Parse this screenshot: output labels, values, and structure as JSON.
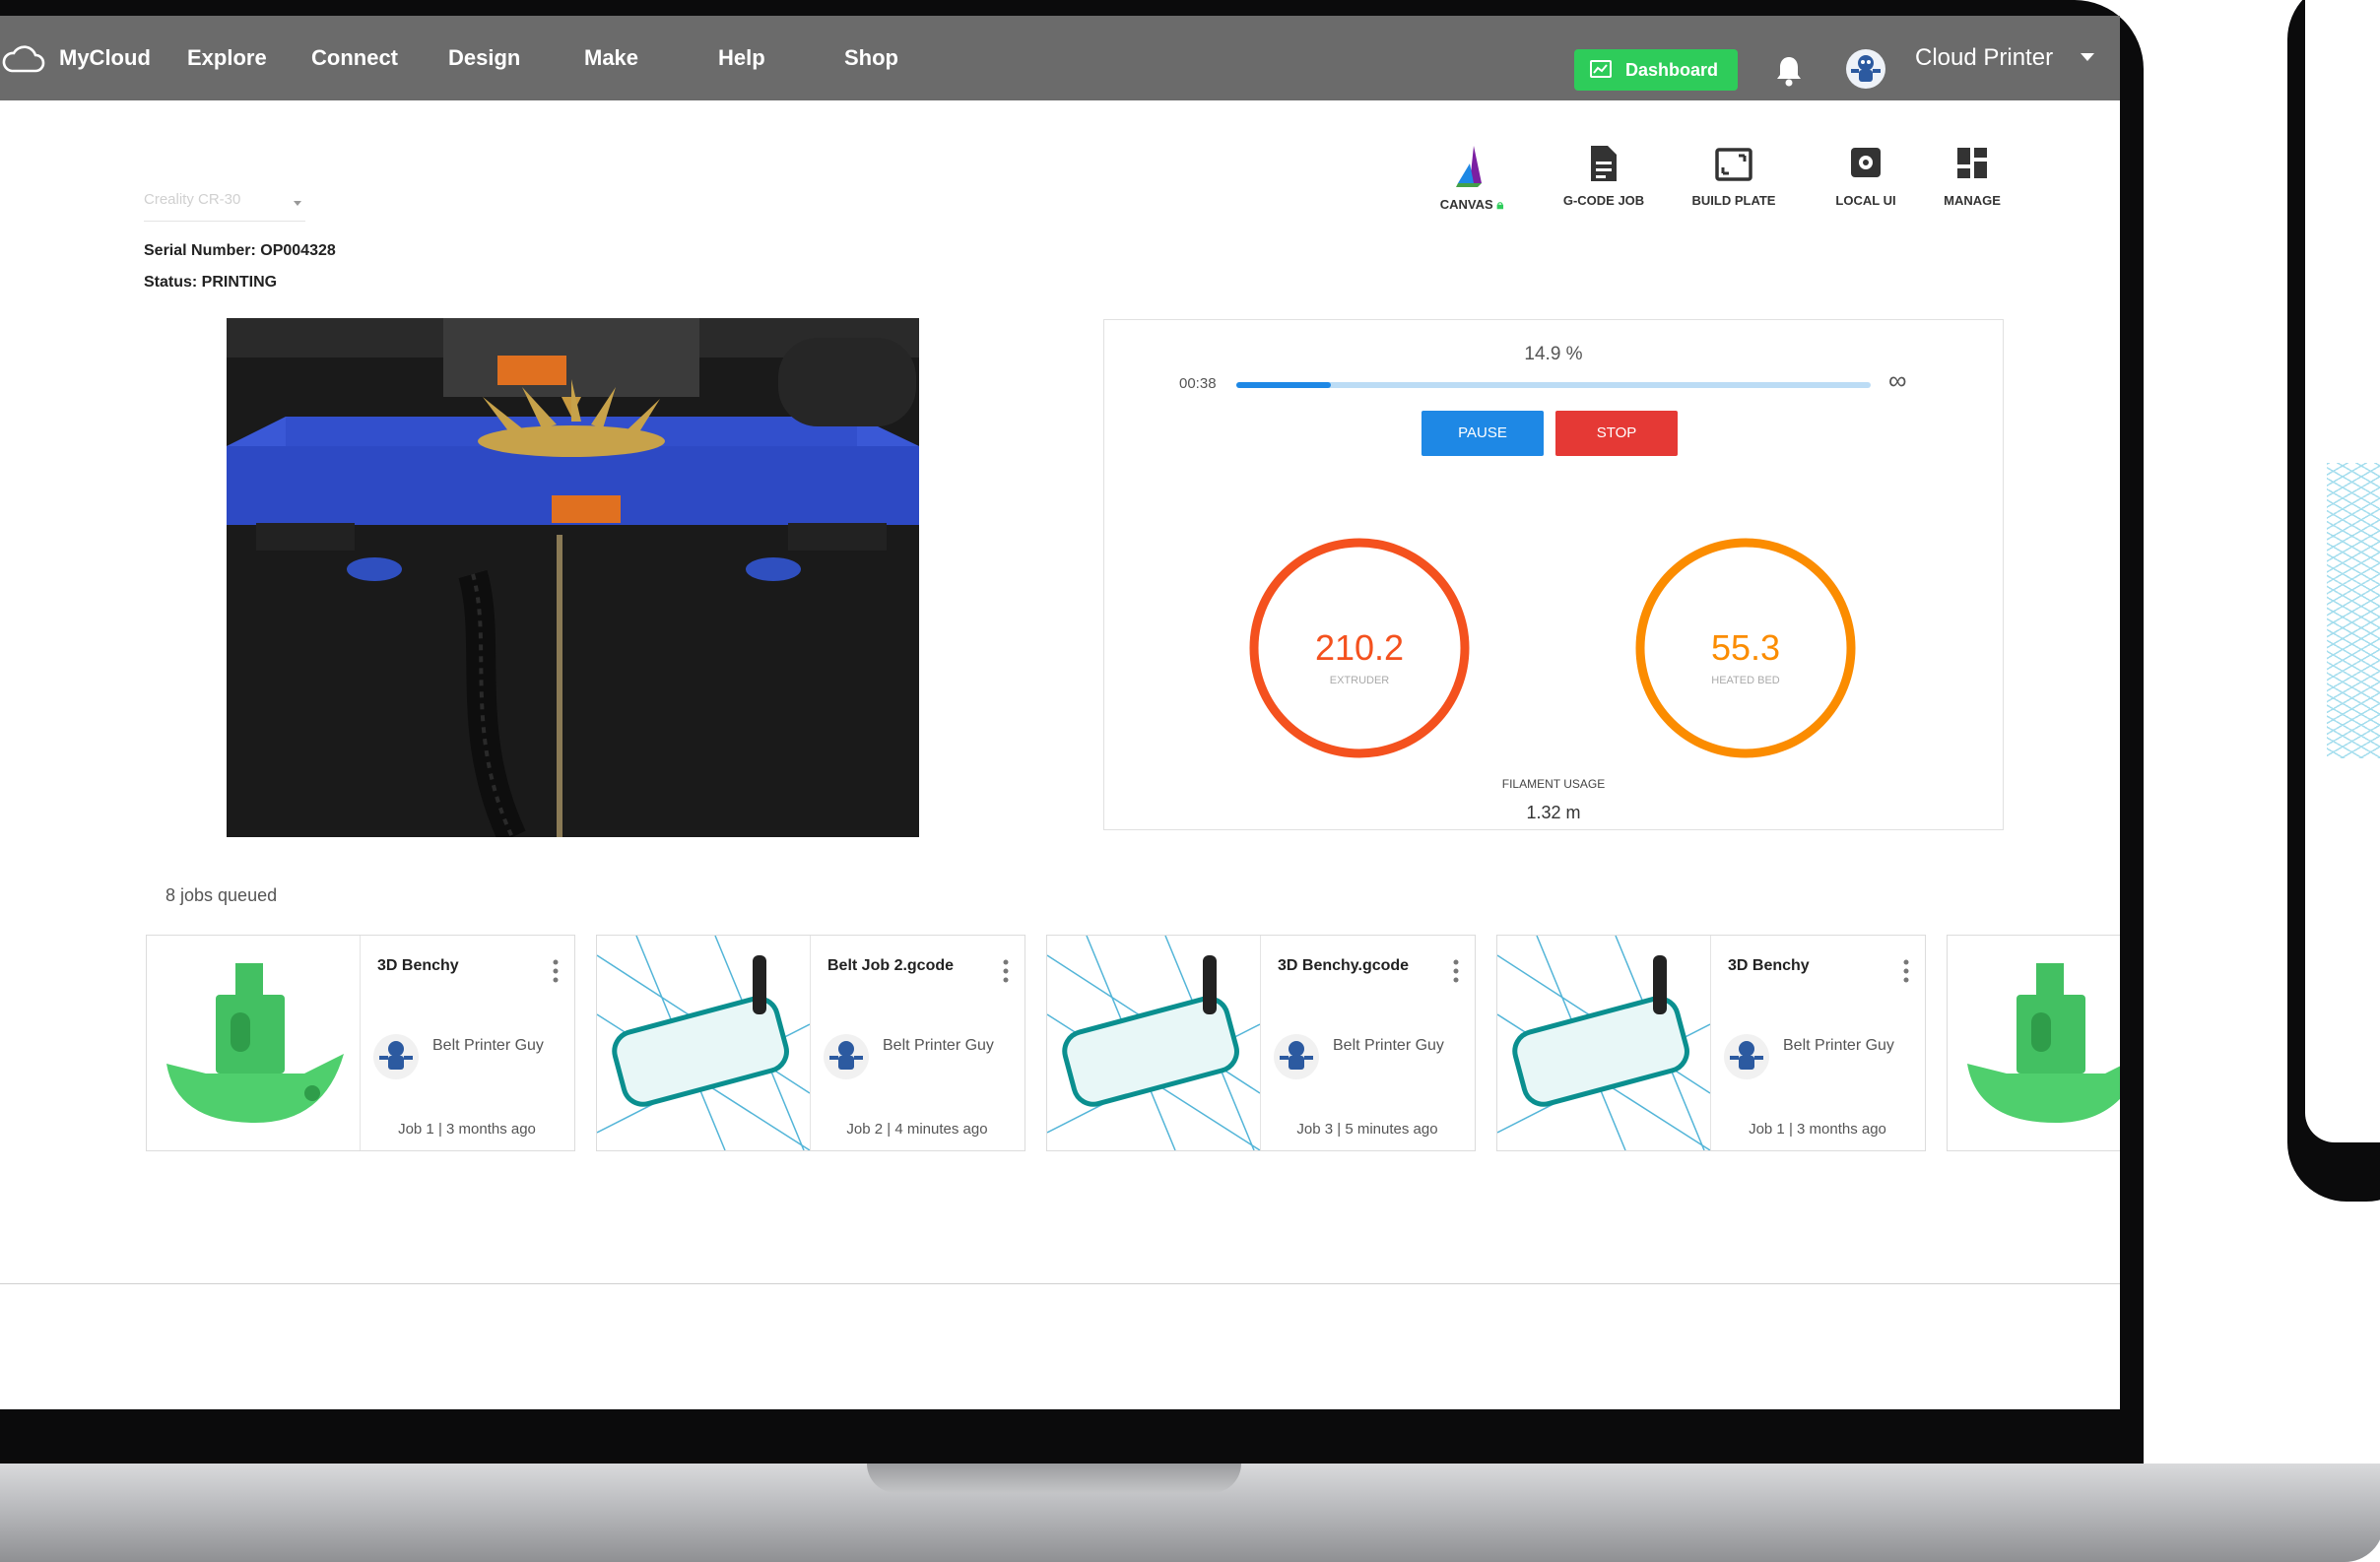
{
  "nav": {
    "brand": "MyCloud",
    "items": [
      "Explore",
      "Connect",
      "Design",
      "Make",
      "Help",
      "Shop"
    ],
    "dashboard_label": "Dashboard",
    "user_name": "Cloud Printer"
  },
  "printer": {
    "selected_model": "Creality CR-30",
    "serial": "Serial Number: OP004328",
    "status": "Status: PRINTING"
  },
  "tools": [
    {
      "label": "CANVAS",
      "icon": "canvas-logo-icon"
    },
    {
      "label": "G-CODE JOB",
      "icon": "document-icon"
    },
    {
      "label": "BUILD PLATE",
      "icon": "build-plate-icon"
    },
    {
      "label": "LOCAL UI",
      "icon": "local-ui-icon"
    },
    {
      "label": "MANAGE",
      "icon": "dashboard-grid-icon"
    }
  ],
  "print": {
    "percent_text": "14.9 %",
    "progress": 0.149,
    "elapsed": "00:38",
    "remaining": "∞",
    "pause_label": "PAUSE",
    "stop_label": "STOP",
    "extruder_temp": "210.2",
    "extruder_label": "EXTRUDER",
    "extruder_color": "#f4511e",
    "bed_temp": "55.3",
    "bed_label": "HEATED BED",
    "bed_color": "#fb8c00",
    "filament_label": "FILAMENT USAGE",
    "filament_value": "1.32 m"
  },
  "queue": {
    "title": "8 jobs queued",
    "jobs": [
      {
        "name": "3D Benchy",
        "user": "Belt Printer Guy",
        "meta": "Job 1 | 3 months ago",
        "thumb": "benchy"
      },
      {
        "name": "Belt Job 2.gcode",
        "user": "Belt Printer Guy",
        "meta": "Job 2 | 4 minutes ago",
        "thumb": "gcode"
      },
      {
        "name": "3D Benchy.gcode",
        "user": "Belt Printer Guy",
        "meta": "Job 3 | 5 minutes ago",
        "thumb": "gcode"
      },
      {
        "name": "3D Benchy",
        "user": "Belt Printer Guy",
        "meta": "Job 1 | 3 months ago",
        "thumb": "gcode"
      }
    ]
  },
  "colors": {
    "nav_bg": "#6b6b6b",
    "dashboard_green": "#2ecc5a",
    "pause_blue": "#1e88e5",
    "stop_red": "#e53935"
  }
}
